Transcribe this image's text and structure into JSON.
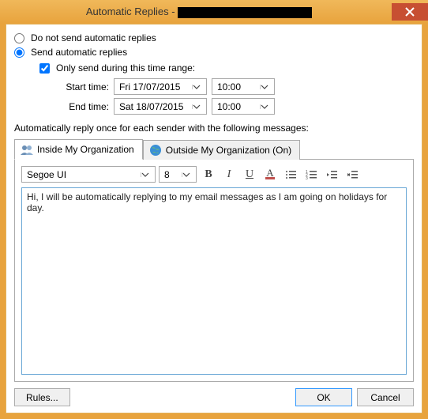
{
  "window": {
    "title_prefix": "Automatic Replies - "
  },
  "radios": {
    "do_not_send": "Do not send automatic replies",
    "send": "Send automatic replies"
  },
  "time_range": {
    "only_send_label": "Only send during this time range:",
    "start_label": "Start time:",
    "end_label": "End time:",
    "start_date": "Fri 17/07/2015",
    "start_time": "10:00",
    "end_date": "Sat 18/07/2015",
    "end_time": "10:00"
  },
  "msg_label": "Automatically reply once for each sender with the following messages:",
  "tabs": {
    "inside": "Inside My Organization",
    "outside": "Outside My Organization (On)"
  },
  "toolbar": {
    "font": "Segoe UI",
    "size": "8"
  },
  "editor": {
    "text": "Hi, I will be automatically replying to my email messages as I am going on holidays for day."
  },
  "buttons": {
    "rules": "Rules...",
    "ok": "OK",
    "cancel": "Cancel"
  }
}
